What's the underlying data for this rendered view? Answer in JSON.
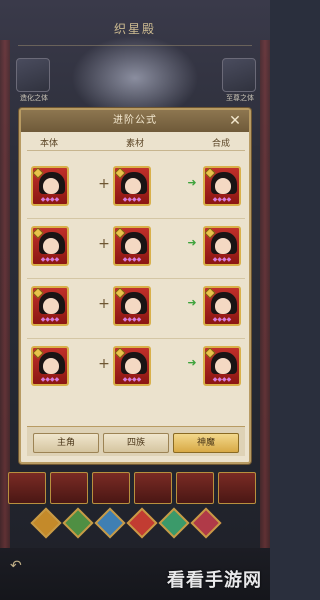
{
  "screen": {
    "title": "织星殿",
    "left_icon_label": "造化之体",
    "right_icon_label": "至尊之体"
  },
  "modal": {
    "title": "进阶公式",
    "close_symbol": "✕",
    "columns": [
      "本体",
      "素材",
      "合成"
    ],
    "rows": [
      {
        "base_stars": "◆◆◆◆",
        "material_stars": "◆◆◆◆",
        "result_stars": "◆◆◆◆",
        "plus": "+",
        "arrow": "➜"
      },
      {
        "base_stars": "◆◆◆◆",
        "material_stars": "◆◆◆◆",
        "result_stars": "◆◆◆◆",
        "plus": "+",
        "arrow": "➜"
      },
      {
        "base_stars": "◆◆◆◆",
        "material_stars": "◆◆◆◆",
        "result_stars": "◆◆◆◆",
        "plus": "+",
        "arrow": "➜"
      },
      {
        "base_stars": "◆◆◆◆",
        "material_stars": "◆◆◆◆",
        "result_stars": "◆◆◆◆",
        "plus": "+",
        "arrow": "➜"
      }
    ],
    "tabs": [
      {
        "label": "主角",
        "active": false
      },
      {
        "label": "四族",
        "active": false
      },
      {
        "label": "神魔",
        "active": true
      }
    ]
  },
  "skills": [
    "earth",
    "wind",
    "water",
    "fire",
    "wood",
    "spirit"
  ],
  "colors": {
    "modal_bg": "#ebe2cd",
    "header_brown": "#7a6342",
    "card_red": "#b3231d",
    "gold_border": "#d9b04a",
    "arrow_green": "#3ea33c",
    "active_tab": "#e3bb5a"
  },
  "watermark": "看看手游网",
  "back_icon": "back-arrow-icon"
}
